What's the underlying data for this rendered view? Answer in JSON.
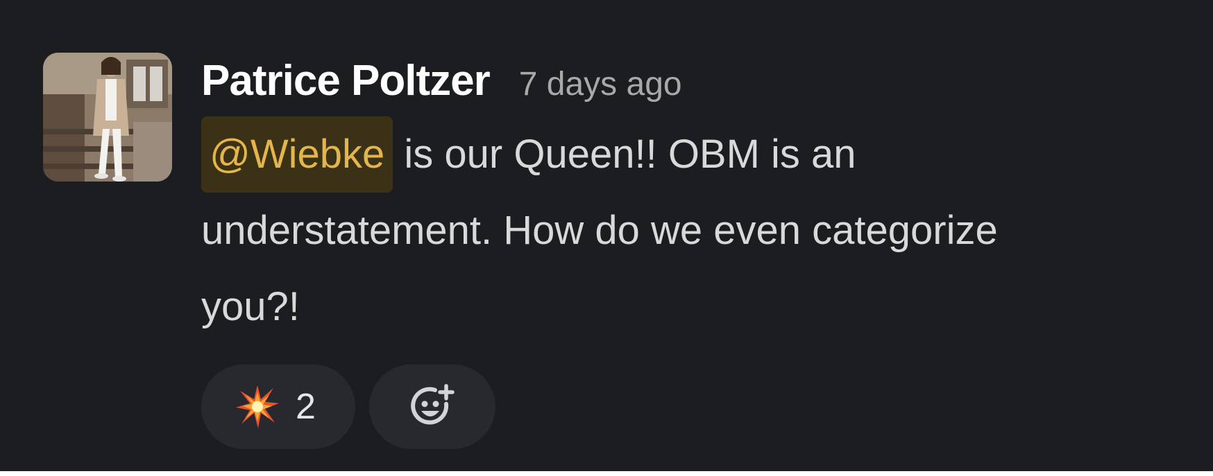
{
  "message": {
    "author": "Patrice Poltzer",
    "timestamp": "7 days ago",
    "mention": "@Wiebke",
    "text_after_mention": " is our Queen!! OBM is an understatement.  How do we even categorize you?!",
    "avatar_icon": "user-photo-avatar"
  },
  "reactions": [
    {
      "emoji_name": "collision-icon",
      "count": "2"
    }
  ],
  "add_reaction": {
    "icon": "add-reaction-icon"
  },
  "colors": {
    "background": "#1b1d21",
    "author": "#ffffff",
    "timestamp": "#a8a9ab",
    "body_text": "#d8d9da",
    "mention_text": "#e4b54a",
    "mention_bg": "#3a3116",
    "pill_bg": "#27292e"
  }
}
